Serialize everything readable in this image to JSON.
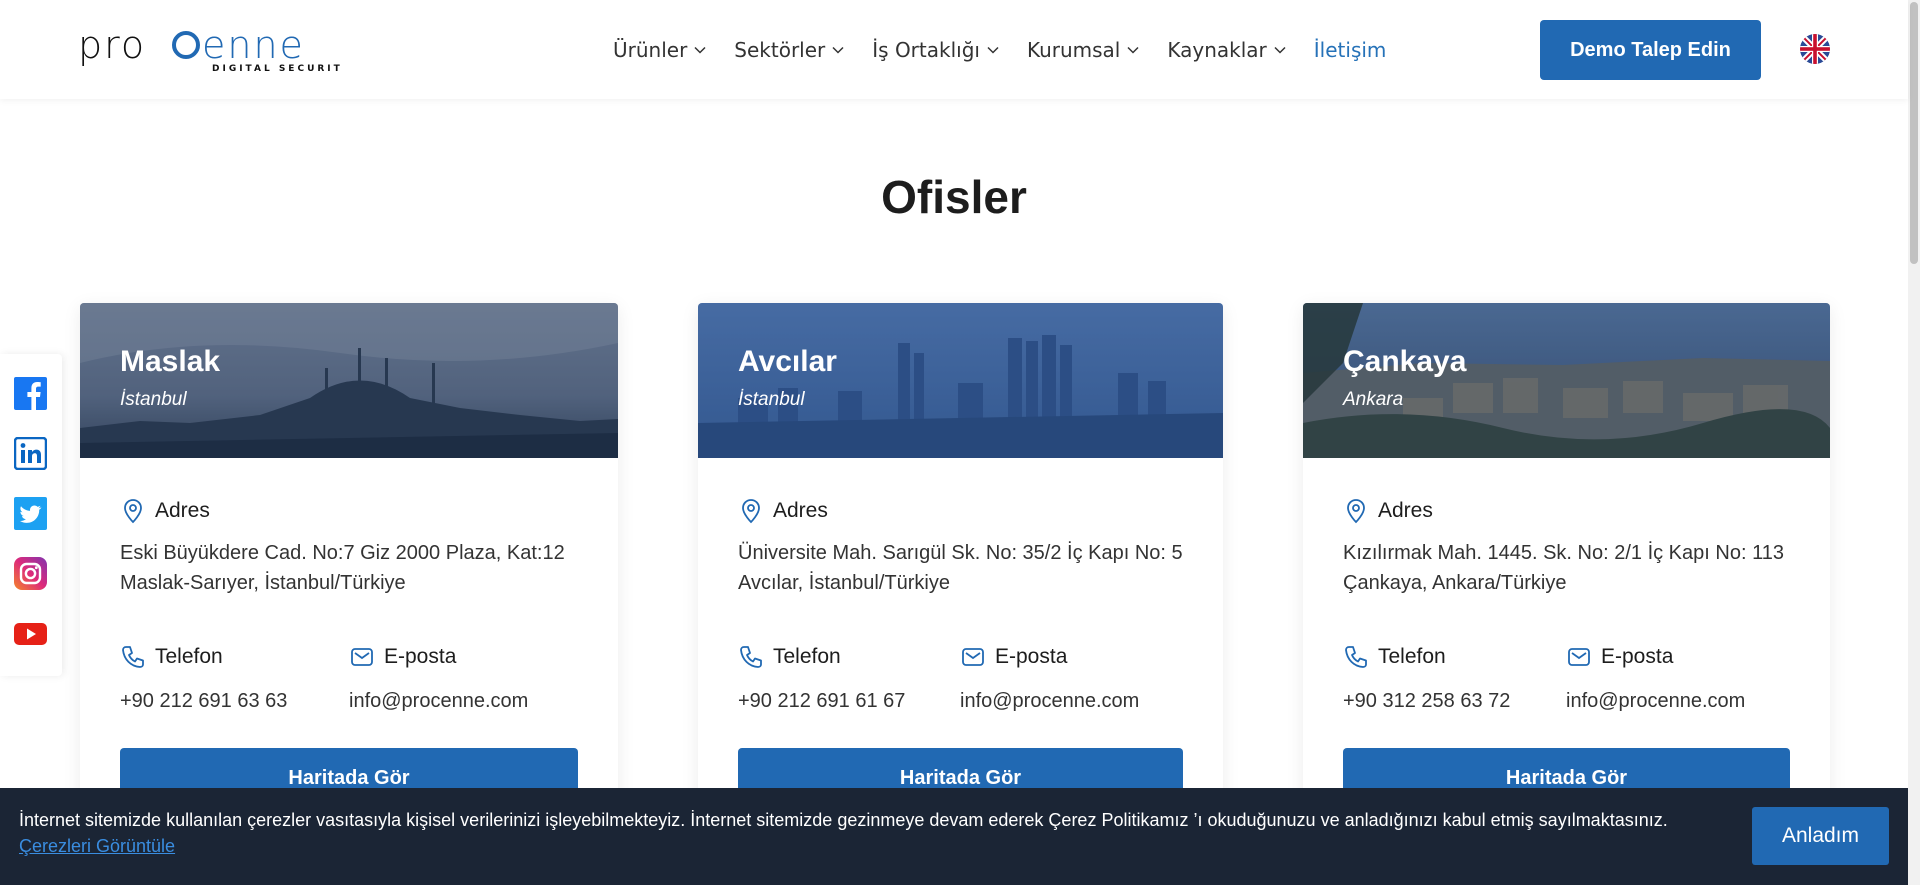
{
  "brand": {
    "logo_text": "procenne",
    "logo_tagline": "DIGITAL SECURITY",
    "accent_color": "#2169b3"
  },
  "nav": {
    "items": [
      {
        "label": "Ürünler",
        "has_dropdown": true
      },
      {
        "label": "Sektörler",
        "has_dropdown": true
      },
      {
        "label": "İş Ortaklığı",
        "has_dropdown": true
      },
      {
        "label": "Kurumsal",
        "has_dropdown": true
      },
      {
        "label": "Kaynaklar",
        "has_dropdown": true
      },
      {
        "label": "İletişim",
        "has_dropdown": false,
        "active": true
      }
    ],
    "demo_button": "Demo Talep Edin",
    "language_icon": "uk-flag-icon"
  },
  "social": [
    "facebook-icon",
    "linkedin-icon",
    "twitter-icon",
    "instagram-icon",
    "youtube-icon"
  ],
  "page": {
    "title": "Ofisler"
  },
  "labels": {
    "address": "Adres",
    "phone": "Telefon",
    "email": "E-posta",
    "map_button": "Haritada Gör"
  },
  "offices": [
    {
      "city": "Maslak",
      "region": "İstanbul",
      "address": "Eski Büyükdere Cad. No:7 Giz 2000 Plaza, Kat:12 Maslak-Sarıyer, İstanbul/Türkiye",
      "phone": "+90 212 691 63 63",
      "email": "info@procenne.com"
    },
    {
      "city": "Avcılar",
      "region": "İstanbul",
      "address": "Üniversite Mah. Sarıgül Sk. No: 35/2 İç Kapı No: 5 Avcılar, İstanbul/Türkiye",
      "phone": "+90 212 691 61 67",
      "email": "info@procenne.com"
    },
    {
      "city": "Çankaya",
      "region": "Ankara",
      "address": "Kızılırmak Mah. 1445. Sk. No: 2/1 İç Kapı No: 113 Çankaya, Ankara/Türkiye",
      "phone": "+90 312 258 63 72",
      "email": "info@procenne.com"
    }
  ],
  "cookie": {
    "text": "İnternet sitemizde kullanılan çerezler vasıtasıyla kişisel verilerinizi işleyebilmekteyiz. İnternet sitemizde gezinmeye devam ederek Çerez Politikamız ’ı okuduğunuzu ve anladığınızı kabul etmiş sayılmaktasınız.",
    "link": "Çerezleri Görüntüle",
    "button": "Anladım"
  }
}
